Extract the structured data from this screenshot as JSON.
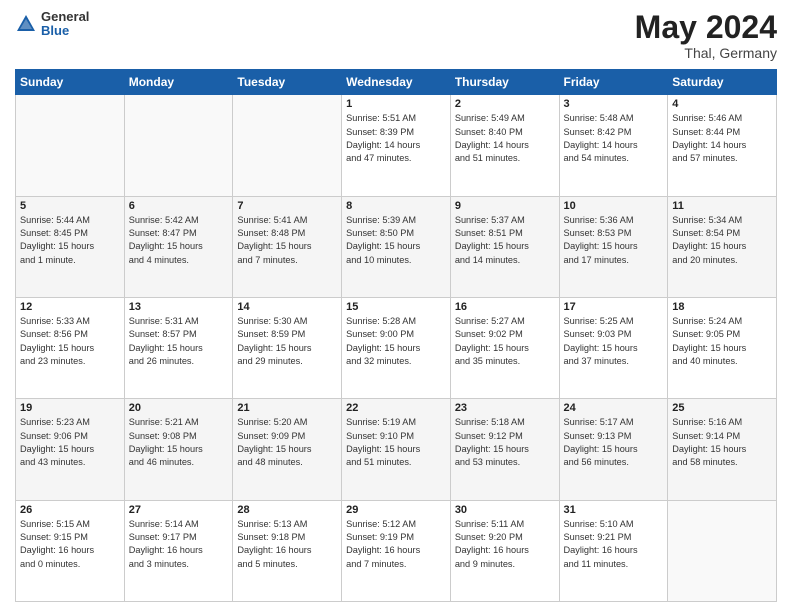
{
  "header": {
    "logo_line1": "General",
    "logo_line2": "Blue",
    "month_year": "May 2024",
    "location": "Thal, Germany"
  },
  "weekdays": [
    "Sunday",
    "Monday",
    "Tuesday",
    "Wednesday",
    "Thursday",
    "Friday",
    "Saturday"
  ],
  "weeks": [
    [
      {
        "day": "",
        "info": ""
      },
      {
        "day": "",
        "info": ""
      },
      {
        "day": "",
        "info": ""
      },
      {
        "day": "1",
        "info": "Sunrise: 5:51 AM\nSunset: 8:39 PM\nDaylight: 14 hours\nand 47 minutes."
      },
      {
        "day": "2",
        "info": "Sunrise: 5:49 AM\nSunset: 8:40 PM\nDaylight: 14 hours\nand 51 minutes."
      },
      {
        "day": "3",
        "info": "Sunrise: 5:48 AM\nSunset: 8:42 PM\nDaylight: 14 hours\nand 54 minutes."
      },
      {
        "day": "4",
        "info": "Sunrise: 5:46 AM\nSunset: 8:44 PM\nDaylight: 14 hours\nand 57 minutes."
      }
    ],
    [
      {
        "day": "5",
        "info": "Sunrise: 5:44 AM\nSunset: 8:45 PM\nDaylight: 15 hours\nand 1 minute."
      },
      {
        "day": "6",
        "info": "Sunrise: 5:42 AM\nSunset: 8:47 PM\nDaylight: 15 hours\nand 4 minutes."
      },
      {
        "day": "7",
        "info": "Sunrise: 5:41 AM\nSunset: 8:48 PM\nDaylight: 15 hours\nand 7 minutes."
      },
      {
        "day": "8",
        "info": "Sunrise: 5:39 AM\nSunset: 8:50 PM\nDaylight: 15 hours\nand 10 minutes."
      },
      {
        "day": "9",
        "info": "Sunrise: 5:37 AM\nSunset: 8:51 PM\nDaylight: 15 hours\nand 14 minutes."
      },
      {
        "day": "10",
        "info": "Sunrise: 5:36 AM\nSunset: 8:53 PM\nDaylight: 15 hours\nand 17 minutes."
      },
      {
        "day": "11",
        "info": "Sunrise: 5:34 AM\nSunset: 8:54 PM\nDaylight: 15 hours\nand 20 minutes."
      }
    ],
    [
      {
        "day": "12",
        "info": "Sunrise: 5:33 AM\nSunset: 8:56 PM\nDaylight: 15 hours\nand 23 minutes."
      },
      {
        "day": "13",
        "info": "Sunrise: 5:31 AM\nSunset: 8:57 PM\nDaylight: 15 hours\nand 26 minutes."
      },
      {
        "day": "14",
        "info": "Sunrise: 5:30 AM\nSunset: 8:59 PM\nDaylight: 15 hours\nand 29 minutes."
      },
      {
        "day": "15",
        "info": "Sunrise: 5:28 AM\nSunset: 9:00 PM\nDaylight: 15 hours\nand 32 minutes."
      },
      {
        "day": "16",
        "info": "Sunrise: 5:27 AM\nSunset: 9:02 PM\nDaylight: 15 hours\nand 35 minutes."
      },
      {
        "day": "17",
        "info": "Sunrise: 5:25 AM\nSunset: 9:03 PM\nDaylight: 15 hours\nand 37 minutes."
      },
      {
        "day": "18",
        "info": "Sunrise: 5:24 AM\nSunset: 9:05 PM\nDaylight: 15 hours\nand 40 minutes."
      }
    ],
    [
      {
        "day": "19",
        "info": "Sunrise: 5:23 AM\nSunset: 9:06 PM\nDaylight: 15 hours\nand 43 minutes."
      },
      {
        "day": "20",
        "info": "Sunrise: 5:21 AM\nSunset: 9:08 PM\nDaylight: 15 hours\nand 46 minutes."
      },
      {
        "day": "21",
        "info": "Sunrise: 5:20 AM\nSunset: 9:09 PM\nDaylight: 15 hours\nand 48 minutes."
      },
      {
        "day": "22",
        "info": "Sunrise: 5:19 AM\nSunset: 9:10 PM\nDaylight: 15 hours\nand 51 minutes."
      },
      {
        "day": "23",
        "info": "Sunrise: 5:18 AM\nSunset: 9:12 PM\nDaylight: 15 hours\nand 53 minutes."
      },
      {
        "day": "24",
        "info": "Sunrise: 5:17 AM\nSunset: 9:13 PM\nDaylight: 15 hours\nand 56 minutes."
      },
      {
        "day": "25",
        "info": "Sunrise: 5:16 AM\nSunset: 9:14 PM\nDaylight: 15 hours\nand 58 minutes."
      }
    ],
    [
      {
        "day": "26",
        "info": "Sunrise: 5:15 AM\nSunset: 9:15 PM\nDaylight: 16 hours\nand 0 minutes."
      },
      {
        "day": "27",
        "info": "Sunrise: 5:14 AM\nSunset: 9:17 PM\nDaylight: 16 hours\nand 3 minutes."
      },
      {
        "day": "28",
        "info": "Sunrise: 5:13 AM\nSunset: 9:18 PM\nDaylight: 16 hours\nand 5 minutes."
      },
      {
        "day": "29",
        "info": "Sunrise: 5:12 AM\nSunset: 9:19 PM\nDaylight: 16 hours\nand 7 minutes."
      },
      {
        "day": "30",
        "info": "Sunrise: 5:11 AM\nSunset: 9:20 PM\nDaylight: 16 hours\nand 9 minutes."
      },
      {
        "day": "31",
        "info": "Sunrise: 5:10 AM\nSunset: 9:21 PM\nDaylight: 16 hours\nand 11 minutes."
      },
      {
        "day": "",
        "info": ""
      }
    ]
  ]
}
